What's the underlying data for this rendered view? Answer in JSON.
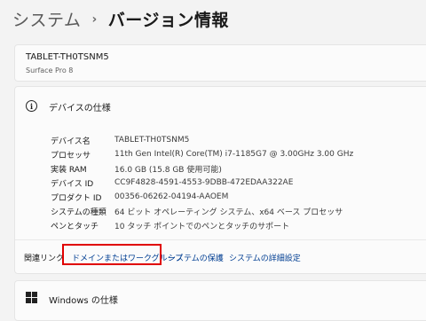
{
  "breadcrumb": {
    "parent": "システム",
    "separator": "›",
    "current": "バージョン情報"
  },
  "device": {
    "name": "TABLET-TH0TSNM5",
    "model": "Surface Pro 8"
  },
  "device_specs": {
    "title": "デバイスの仕様",
    "rows": [
      {
        "label": "デバイス名",
        "value": "TABLET-TH0TSNM5"
      },
      {
        "label": "プロセッサ",
        "value": "11th Gen Intel(R) Core(TM) i7-1185G7 @ 3.00GHz   3.00 GHz"
      },
      {
        "label": "実装 RAM",
        "value": "16.0 GB (15.8 GB 使用可能)"
      },
      {
        "label": "デバイス ID",
        "value": "CC9F4828-4591-4553-9DBB-472EDAA322AE"
      },
      {
        "label": "プロダクト ID",
        "value": "00356-06262-04194-AAOEM"
      },
      {
        "label": "システムの種類",
        "value": "64 ビット オペレーティング システム、x64 ベース プロセッサ"
      },
      {
        "label": "ペンとタッチ",
        "value": "10 タッチ ポイントでのペンとタッチのサポート"
      }
    ]
  },
  "related_links": {
    "label": "関連リンク",
    "links": [
      "ドメインまたはワークグループ",
      "システムの保護",
      "システムの詳細設定"
    ]
  },
  "windows_specs": {
    "title": "Windows の仕様"
  },
  "colors": {
    "link": "#003e92",
    "highlight": "#e00000",
    "background": "#f3f3f3"
  },
  "icons": {
    "info": "info-icon",
    "windows": "windows-logo-icon",
    "chevron": "chevron-right-icon"
  }
}
